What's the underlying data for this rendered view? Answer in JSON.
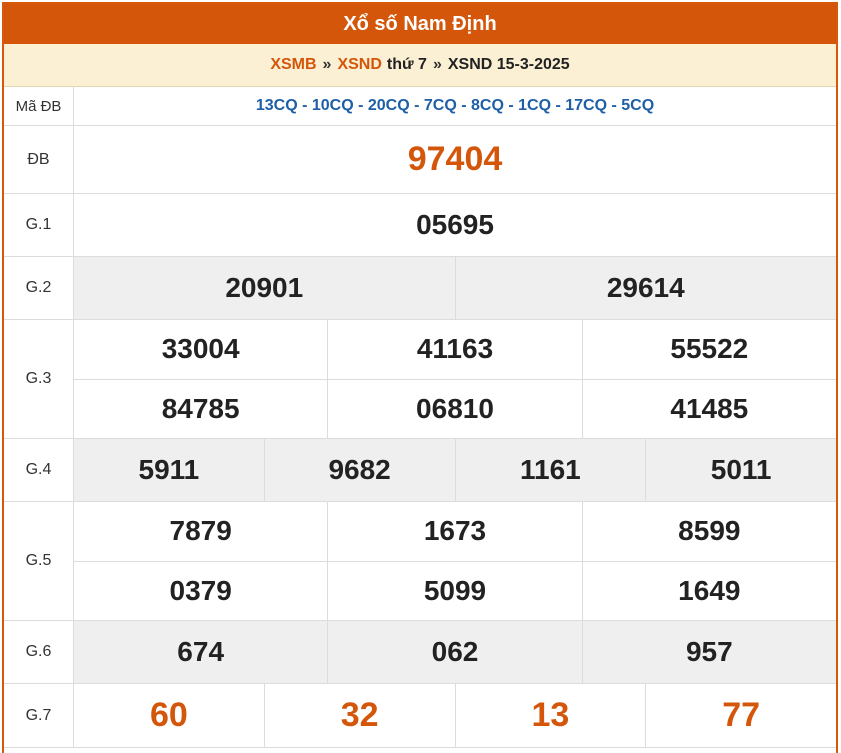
{
  "title": "Xổ số Nam Định",
  "breadcrumb": {
    "link1": "XSMB",
    "sep1": "»",
    "link2": "XSND",
    "text2": "thứ 7",
    "sep2": "»",
    "current": "XSND 15-3-2025"
  },
  "colors": {
    "brand": "#d4560a",
    "code": "#1f5fa6",
    "gray_row": "#efefef"
  },
  "ma_db": {
    "label": "Mã ĐB",
    "codes": "13CQ - 10CQ - 20CQ - 7CQ - 8CQ - 1CQ - 17CQ - 5CQ"
  },
  "prizes": {
    "db": {
      "label": "ĐB",
      "numbers": [
        "97404"
      ]
    },
    "g1": {
      "label": "G.1",
      "numbers": [
        "05695"
      ]
    },
    "g2": {
      "label": "G.2",
      "numbers": [
        "20901",
        "29614"
      ]
    },
    "g3": {
      "label": "G.3",
      "numbers": [
        "33004",
        "41163",
        "55522",
        "84785",
        "06810",
        "41485"
      ]
    },
    "g4": {
      "label": "G.4",
      "numbers": [
        "5911",
        "9682",
        "1161",
        "5011"
      ]
    },
    "g5": {
      "label": "G.5",
      "numbers": [
        "7879",
        "1673",
        "8599",
        "0379",
        "5099",
        "1649"
      ]
    },
    "g6": {
      "label": "G.6",
      "numbers": [
        "674",
        "062",
        "957"
      ]
    },
    "g7": {
      "label": "G.7",
      "numbers": [
        "60",
        "32",
        "13",
        "77"
      ]
    }
  }
}
